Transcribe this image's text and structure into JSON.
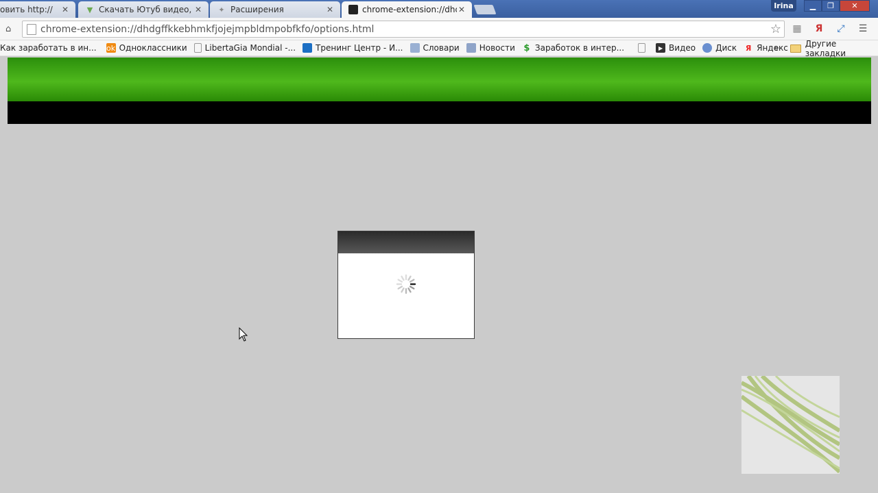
{
  "browser": {
    "tabs": [
      {
        "title": "овить http://",
        "icon": "page-icon",
        "active": false
      },
      {
        "title": "Скачать Ютуб видео, му",
        "icon": "download-icon",
        "active": false
      },
      {
        "title": "Расширения",
        "icon": "puzzle-icon",
        "active": false
      },
      {
        "title": "chrome-extension://dhdg",
        "icon": "extension-icon",
        "active": true
      }
    ],
    "profile_name": "Irina",
    "url": "chrome-extension://dhdgffkkebhmkfjojejmpbldmpobfkfo/options.html",
    "bookmarks": [
      {
        "label": "Как заработать в ин...",
        "icon": "page-icon"
      },
      {
        "label": "Одноклассники",
        "icon": "odnoklassniki-icon"
      },
      {
        "label": "LibertaGia Mondial -...",
        "icon": "page-icon"
      },
      {
        "label": "Тренинг Центр - И...",
        "icon": "training-icon"
      },
      {
        "label": "Словари",
        "icon": "dictionary-icon"
      },
      {
        "label": "Новости",
        "icon": "news-icon"
      },
      {
        "label": "Заработок в интер...",
        "icon": "dollar-icon"
      },
      {
        "label": "",
        "icon": "page-icon"
      },
      {
        "label": "Видео",
        "icon": "video-icon"
      },
      {
        "label": "Диск",
        "icon": "disk-icon"
      },
      {
        "label": "Яндекс",
        "icon": "yandex-icon"
      }
    ],
    "more_label": "»",
    "other_bookmarks": "Другие закладки"
  },
  "colors": {
    "header_green": "#4fb81c",
    "page_bg": "#cbcbcb",
    "modal_header": "#3a3a3a"
  }
}
